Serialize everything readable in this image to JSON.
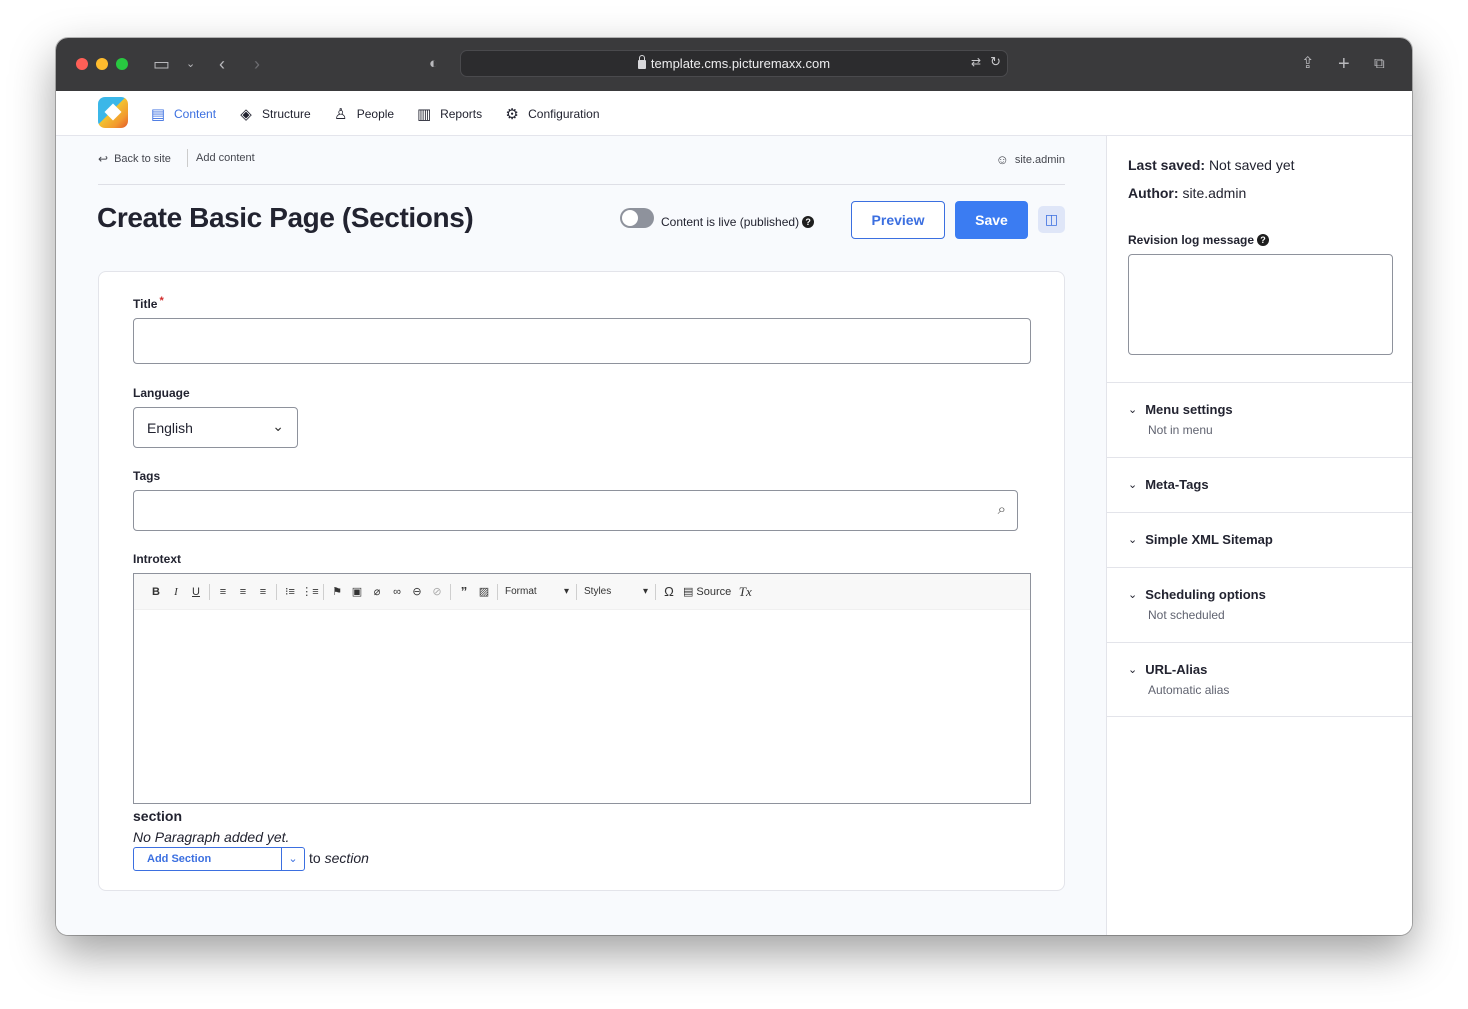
{
  "browser": {
    "url": "template.cms.picturemaxx.com"
  },
  "nav": {
    "items": [
      {
        "label": "Content",
        "icon": "document-icon",
        "active": true
      },
      {
        "label": "Structure",
        "icon": "layers-icon",
        "active": false
      },
      {
        "label": "People",
        "icon": "person-icon",
        "active": false
      },
      {
        "label": "Reports",
        "icon": "bar-chart-icon",
        "active": false
      },
      {
        "label": "Configuration",
        "icon": "gear-icon",
        "active": false
      }
    ]
  },
  "breadcrumb": {
    "back": "Back to site",
    "current": "Add content",
    "user": "site.admin"
  },
  "page": {
    "title": "Create Basic Page (Sections)",
    "published_label": "Content is live (published)",
    "help": "?",
    "preview_label": "Preview",
    "save_label": "Save"
  },
  "form": {
    "title_label": "Title",
    "required_mark": "*",
    "language_label": "Language",
    "language_value": "English",
    "tags_label": "Tags",
    "introtext_label": "Introtext",
    "format_label": "Format",
    "styles_label": "Styles",
    "source_label": "Source",
    "section_title": "section",
    "section_empty": "No Paragraph added yet.",
    "add_section_label": "Add Section",
    "to_text": "to",
    "to_target": "section"
  },
  "sidebar": {
    "last_saved_label": "Last saved:",
    "last_saved_value": "Not saved yet",
    "author_label": "Author:",
    "author_value": "site.admin",
    "revision_label": "Revision log message",
    "accordions": [
      {
        "title": "Menu settings",
        "sub": "Not in menu"
      },
      {
        "title": "Meta-Tags",
        "sub": ""
      },
      {
        "title": "Simple XML Sitemap",
        "sub": ""
      },
      {
        "title": "Scheduling options",
        "sub": "Not scheduled"
      },
      {
        "title": "URL-Alias",
        "sub": "Automatic alias"
      }
    ]
  },
  "colors": {
    "accent": "#3b6fe0",
    "save": "#3b7cf2"
  }
}
